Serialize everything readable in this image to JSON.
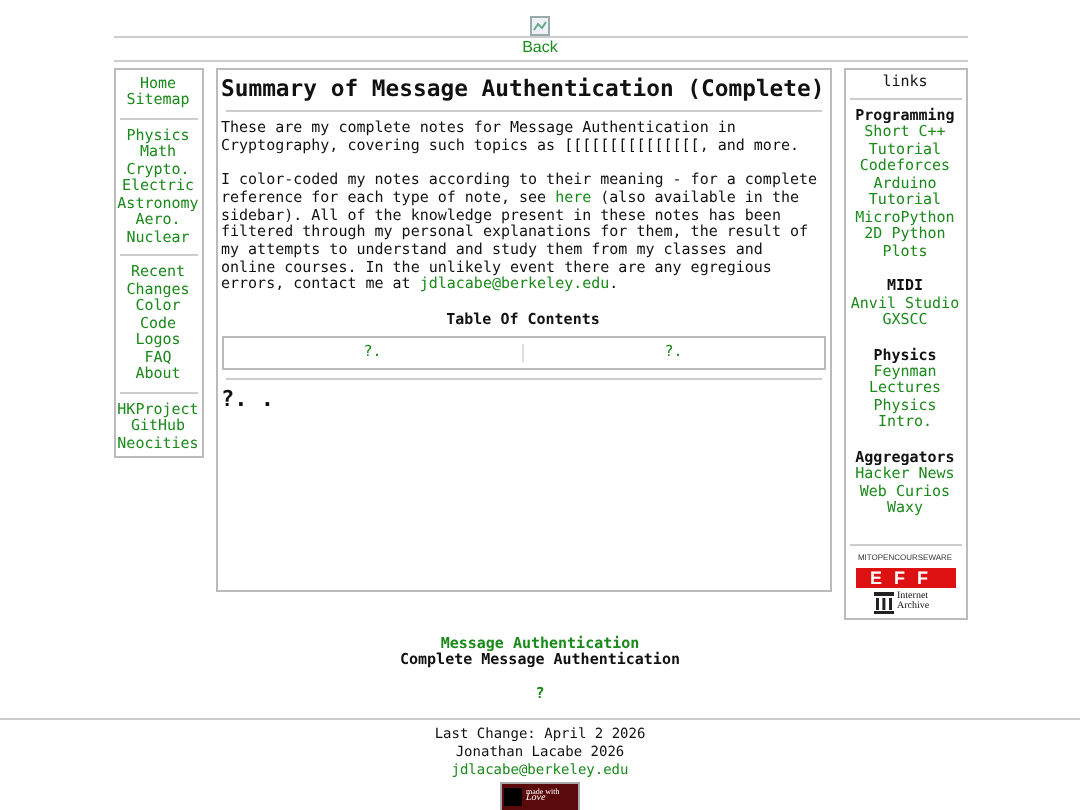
{
  "header": {
    "back_link": "Back"
  },
  "left_nav": [
    [
      "Home",
      "Sitemap"
    ],
    [
      "Physics",
      "Math",
      "Crypto.",
      "Electric",
      "Astronomy",
      "Aero.",
      "Nuclear"
    ],
    [
      "Recent",
      "Changes",
      "Color",
      "Code",
      "Logos",
      "FAQ",
      "About"
    ],
    [
      "HKProject",
      "GitHub",
      "Neocities"
    ]
  ],
  "main": {
    "title": "Summary of Message Authentication (Complete)",
    "paragraphs": [
      [
        {
          "kind": "text",
          "text": "These are my complete notes for Message Authentication in Cryptography, covering such topics as [[[[[[[[[[[[[[[, and more."
        }
      ],
      [
        {
          "kind": "text",
          "text": "I color-coded my notes according to their meaning - for a complete reference for each type of note, see "
        },
        {
          "kind": "link",
          "text": "here"
        },
        {
          "kind": "text",
          "text": " (also available in the sidebar). All of the knowledge present in these notes has been filtered through my personal explanations for them, the result of my attempts to understand and study them from my classes and online courses. In the unlikely event there are any egregious errors, contact me at "
        },
        {
          "kind": "link",
          "text": "jdlacabe@berkeley.edu"
        },
        {
          "kind": "text",
          "text": "."
        }
      ]
    ],
    "toc_heading": "Table Of Contents",
    "toc": [
      "?.",
      "?."
    ],
    "section_heading": "?. ."
  },
  "right_nav": {
    "heading": "links",
    "groups": [
      {
        "title": "Programming",
        "links": [
          "Short C++",
          "Tutorial",
          "Codeforces",
          "Arduino",
          "Tutorial",
          "MicroPython",
          "2D Python",
          "Plots"
        ]
      },
      {
        "title": "MIDI",
        "links": [
          "Anvil Studio",
          "GXSCC"
        ]
      },
      {
        "title": "Physics",
        "links": [
          "Feynman",
          "Lectures",
          "Physics",
          "Intro."
        ]
      },
      {
        "title": "Aggregators",
        "links": [
          "Hacker News",
          "Web Curios",
          "Waxy"
        ]
      }
    ],
    "logos": {
      "ocw": "MITOPENCOURSEWARE",
      "eff": "EFF",
      "archive": "Internet Archive"
    }
  },
  "bottom": {
    "link": "Message Authentication",
    "subtitle": "Complete Message Authentication",
    "question_link": "?"
  },
  "footer": {
    "last_change": "Last Change: April 2 2026",
    "author": "Jonathan Lacabe 2026",
    "email": "jdlacabe@berkeley.edu",
    "badge_top": "made with",
    "badge_bottom": "Love"
  }
}
